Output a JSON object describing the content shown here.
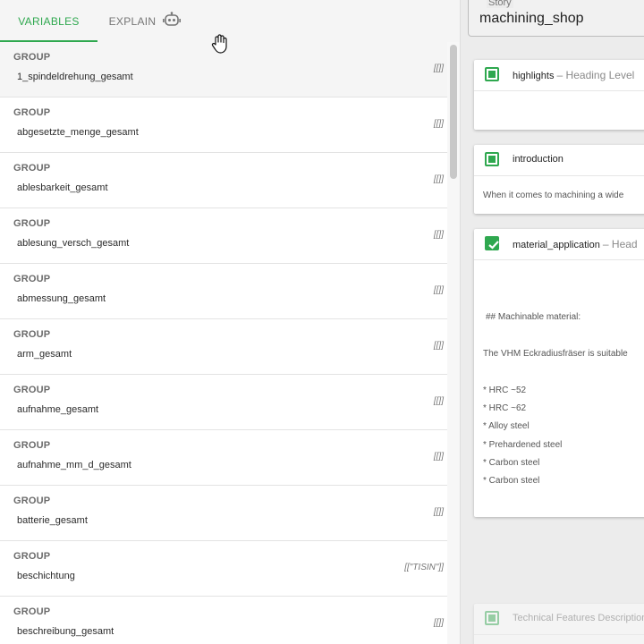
{
  "tabs": {
    "variables": "VARIABLES",
    "explain": "EXPLAIN"
  },
  "variables": [
    {
      "type": "GROUP",
      "name": "1_spindeldrehung_gesamt",
      "value": "[[]]"
    },
    {
      "type": "GROUP",
      "name": "abgesetzte_menge_gesamt",
      "value": "[[]]"
    },
    {
      "type": "GROUP",
      "name": "ablesbarkeit_gesamt",
      "value": "[[]]"
    },
    {
      "type": "GROUP",
      "name": "ablesung_versch_gesamt",
      "value": "[[]]"
    },
    {
      "type": "GROUP",
      "name": "abmessung_gesamt",
      "value": "[[]]"
    },
    {
      "type": "GROUP",
      "name": "arm_gesamt",
      "value": "[[]]"
    },
    {
      "type": "GROUP",
      "name": "aufnahme_gesamt",
      "value": "[[]]"
    },
    {
      "type": "GROUP",
      "name": "aufnahme_mm_d_gesamt",
      "value": "[[]]"
    },
    {
      "type": "GROUP",
      "name": "batterie_gesamt",
      "value": "[[]]"
    },
    {
      "type": "GROUP",
      "name": "beschichtung",
      "value": "[[\"TISIN\"]]"
    },
    {
      "type": "GROUP",
      "name": "beschreibung_gesamt",
      "value": "[[]]"
    }
  ],
  "story": {
    "label": "Story",
    "value": "machining_shop"
  },
  "cards": {
    "highlights": {
      "title": "highlights",
      "subtitle": "– Heading Level"
    },
    "introduction": {
      "title": "introduction",
      "body": "When it comes to machining a wide"
    },
    "material_application": {
      "title": "material_application",
      "subtitle": "– Head",
      "lines": [
        "## Machinable material:",
        "The VHM Eckradiusfräser is suitable",
        "* HRC ~52",
        "* HRC ~62",
        "* Alloy steel",
        "* Prehardened steel",
        "* Carbon steel",
        "* Carbon steel"
      ]
    },
    "technical": {
      "title": "Technical Features Description"
    }
  },
  "colors": {
    "accent": "#2fa84f",
    "text": "#2b2b2b",
    "muted": "#757575"
  },
  "icons": {
    "robot": "robot-icon",
    "cursor": "hand-cursor-icon",
    "checkbox": "checkbox-icon"
  }
}
